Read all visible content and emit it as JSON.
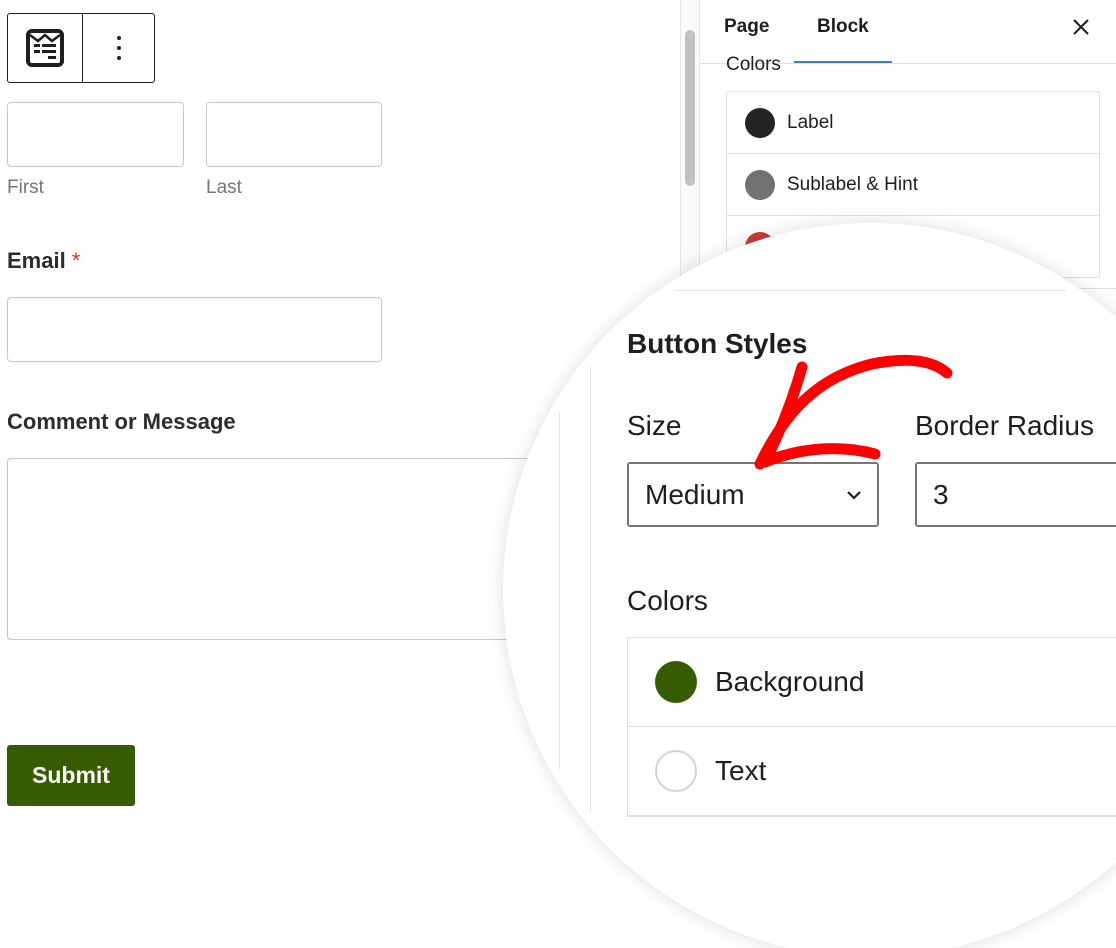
{
  "editor": {
    "toolbar": {
      "form_icon": "form-icon",
      "more_icon": "more-options-vertical-icon"
    },
    "name_field": {
      "first_sublabel": "First",
      "last_sublabel": "Last",
      "first_value": "",
      "last_value": ""
    },
    "email_field": {
      "label": "Email",
      "required_marker": "*",
      "value": ""
    },
    "comment_field": {
      "label": "Comment or Message",
      "value": ""
    },
    "submit_label": "Submit"
  },
  "sidebar": {
    "tabs": [
      {
        "label": "Page",
        "active": false
      },
      {
        "label": "Block",
        "active": true
      }
    ],
    "close_icon": "close-icon",
    "section_heading_partial": "Colors",
    "field_colors": [
      {
        "label": "Label",
        "color": "#242424"
      },
      {
        "label": "Sublabel & Hint",
        "color": "#727272"
      },
      {
        "label": "",
        "color": "#d03a3a"
      }
    ]
  },
  "magnified": {
    "title": "Button Styles",
    "size": {
      "label": "Size",
      "value": "Medium"
    },
    "border_radius": {
      "label": "Border Radius",
      "value": "3"
    },
    "colors": {
      "label": "Colors",
      "items": [
        {
          "label": "Background",
          "color": "#365b00"
        },
        {
          "label": "Text",
          "color": "#ffffff"
        }
      ]
    },
    "annotation": {
      "type": "arrow",
      "color": "#ff0000",
      "points_to": "size-select"
    }
  },
  "colors": {
    "accent": "#3582c4",
    "submit_bg": "#365b00",
    "required": "#d63638"
  }
}
